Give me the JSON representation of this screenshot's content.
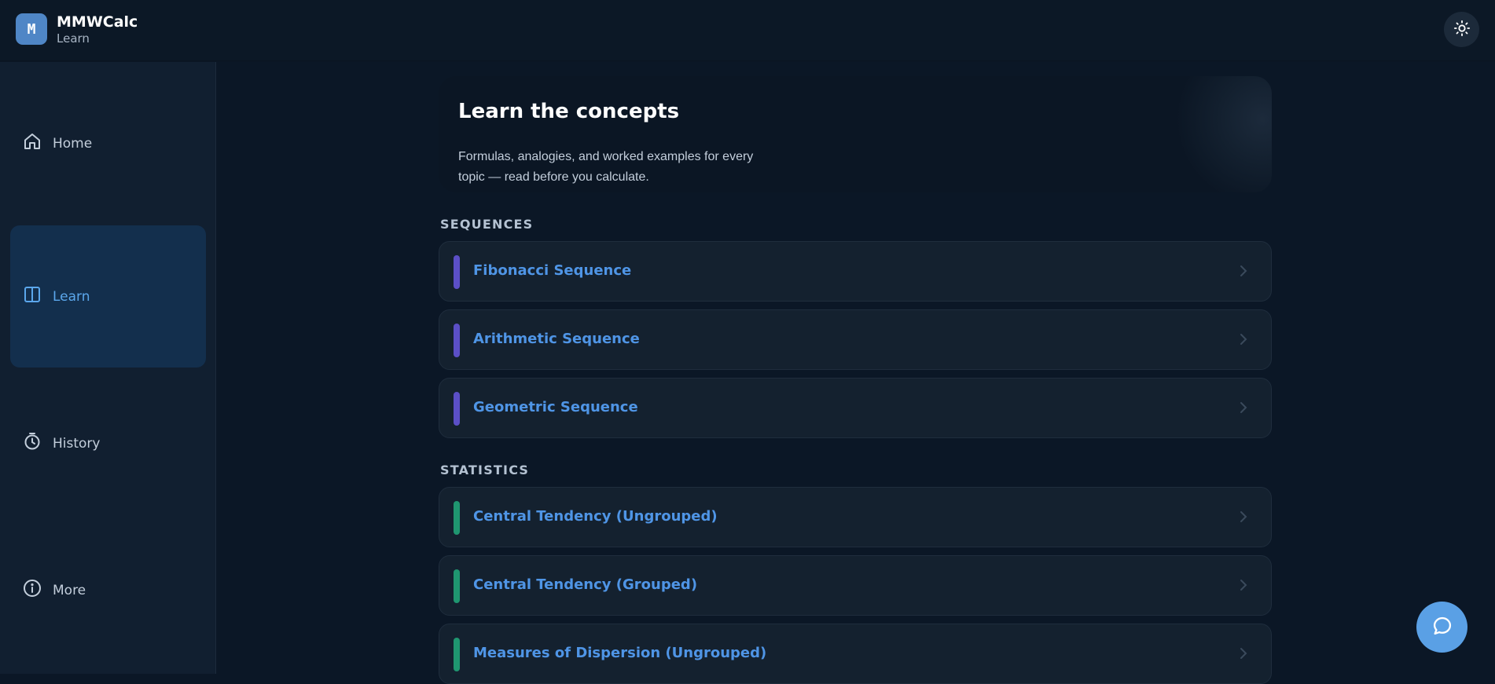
{
  "app": {
    "logo_letter": "M",
    "title": "MMWCalc",
    "subtitle": "Learn"
  },
  "header": {
    "theme_icon": "sun-icon"
  },
  "sidebar": {
    "items": [
      {
        "label": "Home",
        "icon": "home-icon",
        "active": false
      },
      {
        "label": "Learn",
        "icon": "book-icon",
        "active": true
      },
      {
        "label": "History",
        "icon": "stopwatch-icon",
        "active": false
      },
      {
        "label": "More",
        "icon": "info-icon",
        "active": false
      }
    ]
  },
  "hero": {
    "title": "Learn the concepts",
    "description_line1": "Formulas, analogies, and worked examples for every",
    "description_line2": "topic — read before you calculate."
  },
  "sections": [
    {
      "label": "SEQUENCES",
      "accent_color": "#5b4fc7",
      "topics": [
        "Fibonacci Sequence",
        "Arithmetic Sequence",
        "Geometric Sequence"
      ]
    },
    {
      "label": "STATISTICS",
      "accent_color": "#1f9670",
      "topics": [
        "Central Tendency (Ungrouped)",
        "Central Tendency (Grouped)",
        "Measures of Dispersion (Ungrouped)"
      ]
    }
  ],
  "chat": {
    "icon": "chat-bubble-icon"
  },
  "colors": {
    "accent": "#4f95e6",
    "sequences": "#5b4fc7",
    "statistics": "#1f9670",
    "chat_button": "#5aa0e5"
  }
}
